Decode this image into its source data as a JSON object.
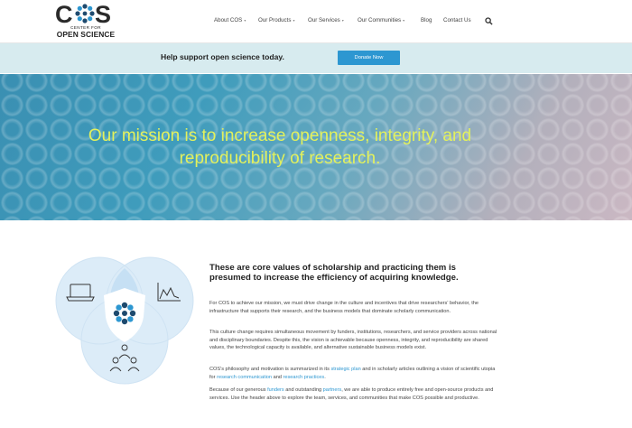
{
  "logo": {
    "mark": "COS",
    "line1": "CENTER FOR",
    "line2": "OPEN SCIENCE"
  },
  "nav": {
    "items": [
      {
        "label": "About COS",
        "dropdown": true
      },
      {
        "label": "Our Products",
        "dropdown": true
      },
      {
        "label": "Our Services",
        "dropdown": true
      },
      {
        "label": "Our Communities",
        "dropdown": true
      },
      {
        "label": "Blog",
        "dropdown": false
      },
      {
        "label": "Contact Us",
        "dropdown": false
      }
    ],
    "caret": "▾",
    "search_icon": "search-icon"
  },
  "donate": {
    "text": "Help support open science today.",
    "button": "Donate Now"
  },
  "hero": {
    "title_line1": "Our mission is to increase openness, integrity, and",
    "title_line2": "reproducibility of research."
  },
  "content": {
    "headline_line1": "These are core values of scholarship and practicing them is",
    "headline_line2": "presumed to increase the efficiency of acquiring knowledge.",
    "p1": "For COS to achieve our mission, we must drive change in the culture and incentives that drive researchers' behavior, the infrastructure that supports their research, and the business models that dominate scholarly communication.",
    "p2": "This culture change requires simultaneous movement by funders, institutions, researchers, and service providers across national and disciplinary boundaries. Despite this, the vision is achievable because openness, integrity, and reproducibility are shared values, the technological capacity is available, and alternative sustainable business models exist.",
    "p3_before": "COS's philosophy and motivation is summarized in its ",
    "p3_link1": "strategic plan",
    "p3_mid": " and in scholarly articles outlining a vision of scientific utopia for ",
    "p3_link2": "research communication",
    "p3_and": " and ",
    "p3_link3": "research practices",
    "p3_end": ".",
    "p4_before": "Because of our generous ",
    "p4_link1": "funders",
    "p4_mid": " and outstanding ",
    "p4_link2": "partners",
    "p4_end": ", we are able to produce entirely free and open-source products and services. Use the header above to explore the team, services, and communities that make COS possible and productive."
  },
  "colors": {
    "accent": "#2d97d1",
    "hero_text": "#e3f15c",
    "donate_bar": "#d7ebef"
  }
}
